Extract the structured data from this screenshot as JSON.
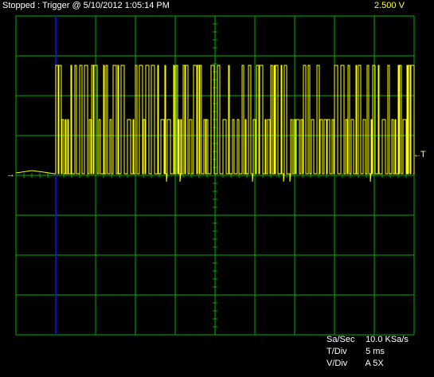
{
  "status": "Stopped : Trigger @ 5/10/2012 1:05:14 PM",
  "voltage": "2.500  V",
  "trigger_marker": "T",
  "ground_marker": "→",
  "readouts": [
    {
      "label": "Sa/Sec",
      "value": "10.0 KSa/s"
    },
    {
      "label": "T/Div",
      "value": "5 ms"
    },
    {
      "label": "V/Div",
      "value": "A 5X"
    }
  ],
  "colors": {
    "grid": "#00b000",
    "trace": "#ffff00",
    "cursor": "#1010ff",
    "background": "#000000"
  }
}
